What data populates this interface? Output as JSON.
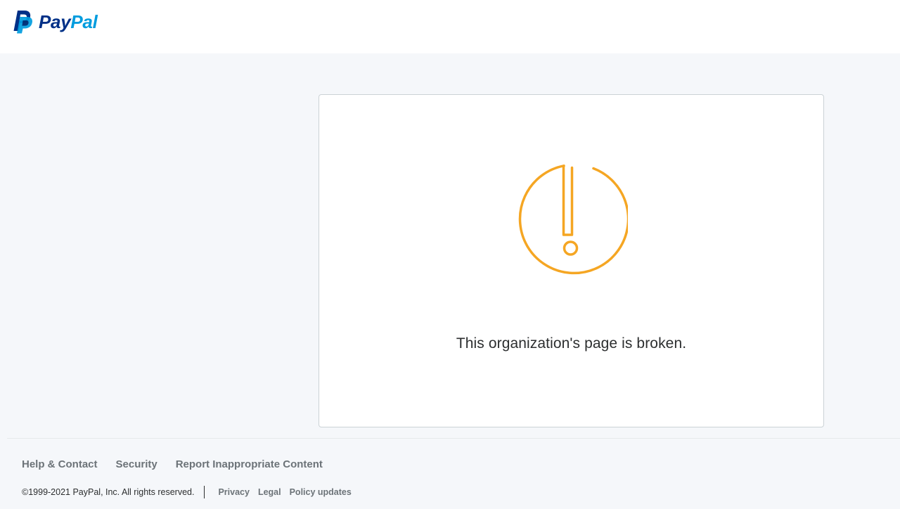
{
  "header": {
    "logo_alt": "PayPal",
    "logo_word_pay": "Pay",
    "logo_word_pal": "Pal",
    "colors": {
      "navy": "#003087",
      "blue": "#009cde"
    }
  },
  "card": {
    "icon": "alert-circle-icon",
    "icon_color": "#f5a623",
    "message": "This organization's page is broken."
  },
  "footer": {
    "links": [
      {
        "label": "Help & Contact"
      },
      {
        "label": "Security"
      },
      {
        "label": "Report Inappropriate Content"
      }
    ],
    "copyright": "©1999-2021 PayPal, Inc. All rights reserved.",
    "legal_links": [
      {
        "label": "Privacy"
      },
      {
        "label": "Legal"
      },
      {
        "label": "Policy updates"
      }
    ]
  }
}
